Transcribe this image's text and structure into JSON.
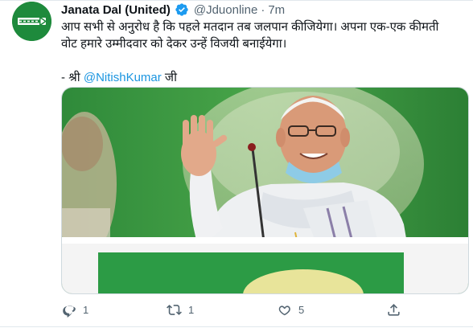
{
  "tweet": {
    "author_name": "Janata Dal (United)",
    "handle": "@Jduonline",
    "separator": "·",
    "time": "7m",
    "text_line1": "आप सभी से अनुरोध है कि पहले मतदान तब जलपान कीजियेगा। अपना एक-एक कीमती",
    "text_line2": "वोट हमारे उम्मीदवार को देकर उन्हें विजयी बनाईयेगा।",
    "quote_prefix": "- श्री ",
    "quote_mention": "@NitishKumar",
    "quote_suffix": " जी"
  },
  "actions": {
    "reply_count": "1",
    "retweet_count": "1",
    "like_count": "5"
  },
  "icons": {
    "verified": "verified-badge-icon",
    "reply": "reply-icon",
    "retweet": "retweet-icon",
    "like": "heart-icon",
    "share": "share-icon"
  },
  "colors": {
    "link": "#1b95e0",
    "verified": "#1d9bf0",
    "avatar_bg": "#1e8a3c",
    "muted": "#536471"
  }
}
